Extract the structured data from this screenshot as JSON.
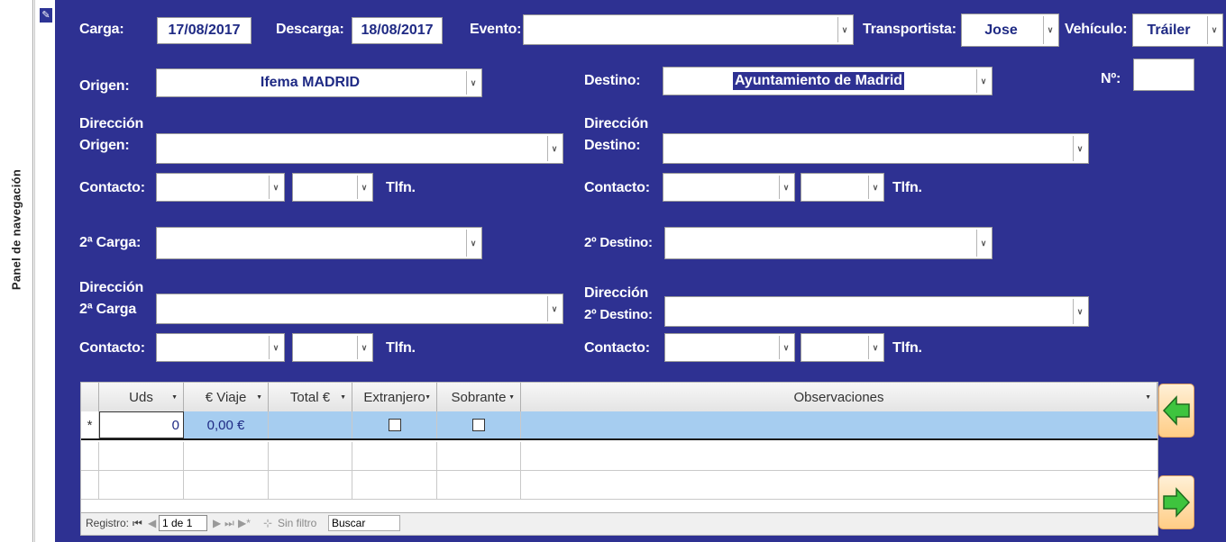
{
  "nav_pane": {
    "label": "Panel de navegación"
  },
  "header": {
    "carga_label": "Carga:",
    "carga_value": "17/08/2017",
    "descarga_label": "Descarga:",
    "descarga_value": "18/08/2017",
    "evento_label": "Evento:",
    "evento_value": "",
    "transportista_label": "Transportista:",
    "transportista_value": "Jose",
    "vehiculo_label": "Vehículo:",
    "vehiculo_value": "Tráiler",
    "numero_label": "Nº:",
    "numero_value": ""
  },
  "origen": {
    "origen_label": "Origen:",
    "origen_value": "Ifema MADRID",
    "direccion_label_1": "Dirección",
    "direccion_label_2": "Origen:",
    "direccion_value": "",
    "contacto_label": "Contacto:",
    "tlfn_label": "Tlfn."
  },
  "destino": {
    "destino_label": "Destino:",
    "destino_value": "Ayuntamiento de Madrid",
    "direccion_label_1": "Dirección",
    "direccion_label_2": "Destino:",
    "direccion_value": "",
    "contacto_label": "Contacto:",
    "tlfn_label": "Tlfn."
  },
  "segunda_carga": {
    "label": "2ª Carga:",
    "value": "",
    "direccion_label_1": "Dirección",
    "direccion_label_2": "2ª Carga",
    "direccion_value": "",
    "contacto_label": "Contacto:",
    "tlfn_label": "Tlfn."
  },
  "segundo_destino": {
    "label": "2º Destino:",
    "value": "",
    "direccion_label_1": "Dirección",
    "direccion_label_2": "2º Destino:",
    "direccion_value": "",
    "contacto_label": "Contacto:",
    "tlfn_label": "Tlfn."
  },
  "grid": {
    "columns": [
      "Uds",
      "€ Viaje",
      "Total €",
      "Extranjero",
      "Sobrante",
      "Observaciones"
    ],
    "new_row": {
      "marker": "*",
      "uds": "0",
      "viaje": "0,00 €",
      "total": "",
      "extranjero": false,
      "sobrante": false,
      "observaciones": ""
    },
    "nav": {
      "registro_label": "Registro:",
      "position": "1 de 1",
      "filter_label": "Sin filtro",
      "search_label": "Buscar"
    }
  },
  "icons": {
    "pencil": "pencil-icon",
    "back": "arrow-left-icon",
    "forward": "arrow-right-icon"
  },
  "colors": {
    "form_bg": "#2e3192",
    "row_selected": "#a6cdf0",
    "arrow_fill": "#3ec43e",
    "button_bg": "#ffcd86"
  }
}
